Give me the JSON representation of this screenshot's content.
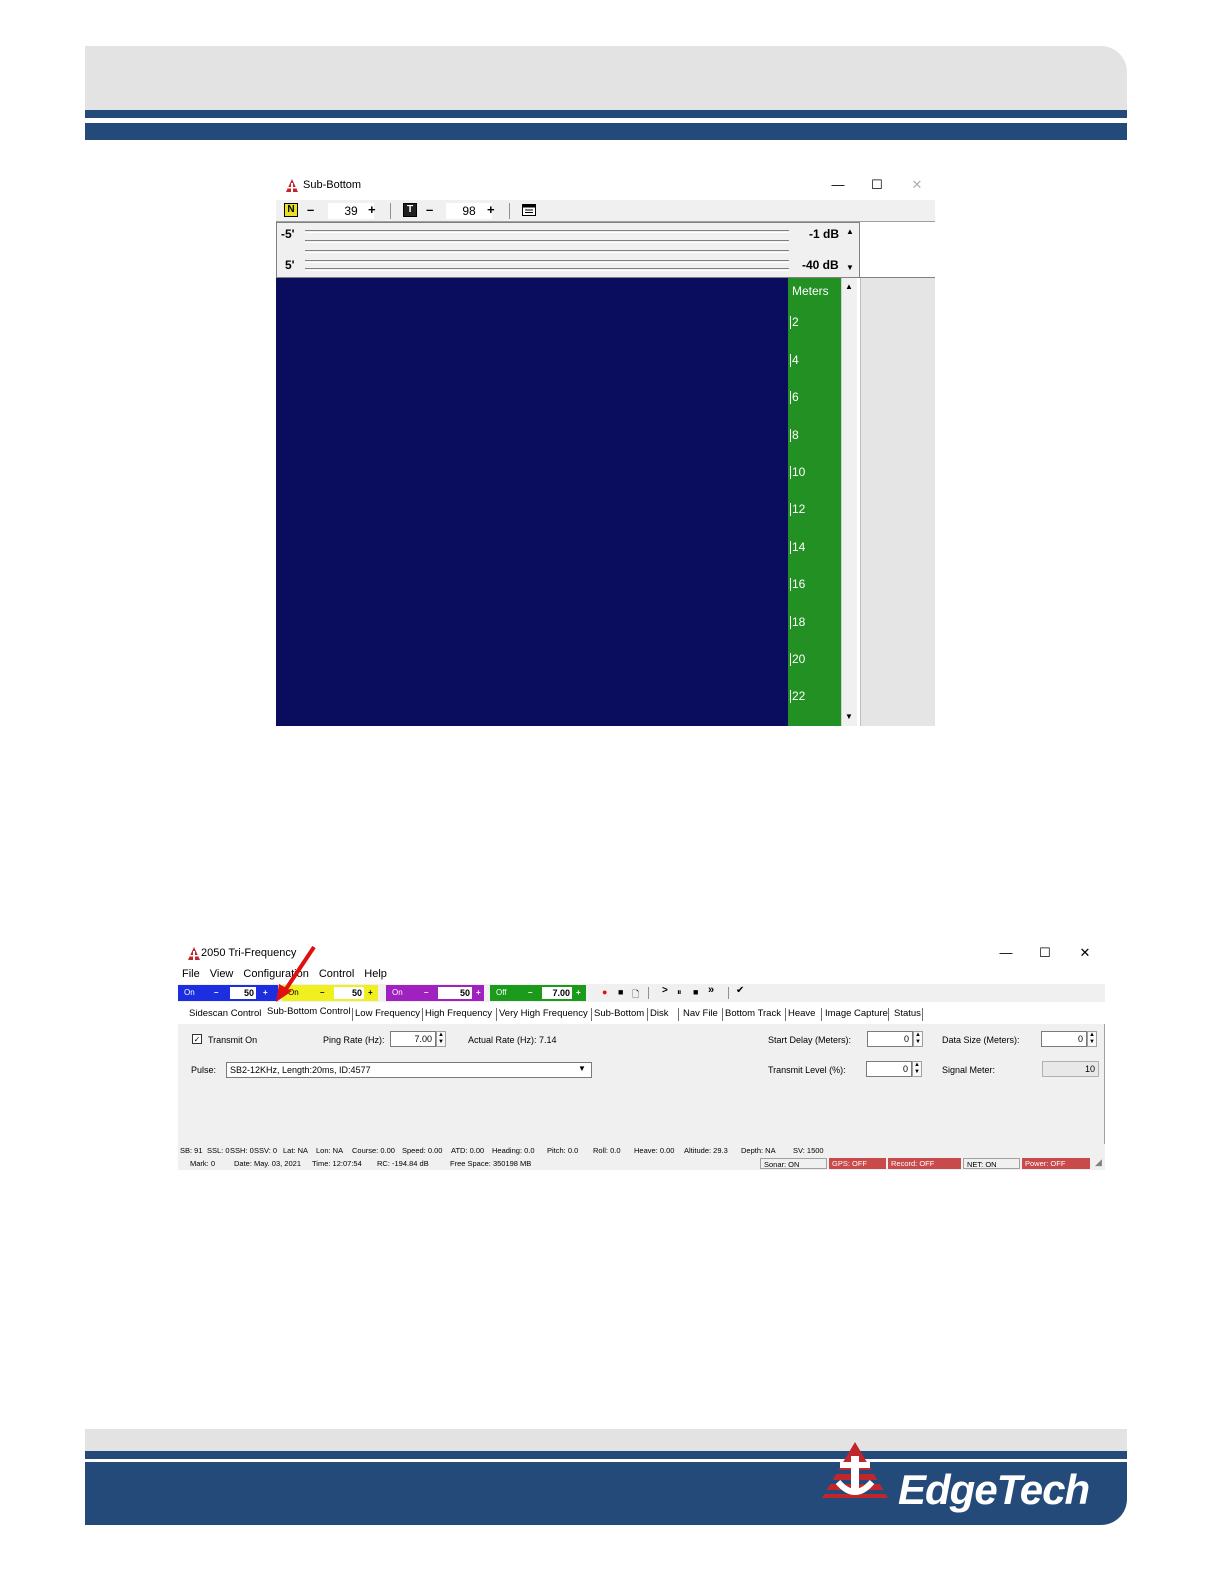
{
  "page": {
    "logo_text": "EdgeTech"
  },
  "sub_bottom_window": {
    "title": "Sub-Bottom",
    "controls": {
      "minimize": "—",
      "maximize": "☐",
      "close": "✕"
    },
    "toolbar": {
      "n_label": "N",
      "n_minus": "–",
      "n_value": "39",
      "n_plus": "+",
      "t_label": "T",
      "t_minus": "–",
      "t_value": "98",
      "t_plus": "+"
    },
    "meter": {
      "top_left": "-5'",
      "bottom_left": "5'",
      "top_right": "-1 dB",
      "bottom_right": "-40 dB"
    },
    "scale": {
      "header": "Meters",
      "ticks": [
        "2",
        "4",
        "6",
        "8",
        "10",
        "12",
        "14",
        "16",
        "18",
        "20",
        "22"
      ]
    },
    "colors": {
      "image_bg": "#0a0c5e",
      "scale_bg": "#239023"
    }
  },
  "tri_freq_window": {
    "title": "2050 Tri-Frequency",
    "controls": {
      "minimize": "—",
      "maximize": "☐",
      "close": "✕"
    },
    "menu": [
      "File",
      "View",
      "Configuration",
      "Control",
      "Help"
    ],
    "toolbar": {
      "blue": {
        "state": "On",
        "minus": "–",
        "value": "50",
        "plus": "+"
      },
      "yellow": {
        "state": "On",
        "minus": "–",
        "value": "50",
        "plus": "+"
      },
      "purple": {
        "state": "On",
        "minus": "–",
        "value": "50",
        "plus": "+"
      },
      "green": {
        "state": "Off",
        "minus": "–",
        "value": "7.00",
        "plus": "+"
      },
      "record_icons": [
        "●",
        "■",
        "🗋",
        ">",
        "⏸",
        "■",
        "»",
        "✔"
      ]
    },
    "tabs": [
      "Sidescan Control",
      "Sub-Bottom Control",
      "Low Frequency",
      "High Frequency",
      "Very High Frequency",
      "Sub-Bottom",
      "Disk",
      "Nav File",
      "Bottom Track",
      "Heave",
      "Image Capture",
      "Status"
    ],
    "panel": {
      "transmit_on_label": "Transmit On",
      "transmit_on_checked": true,
      "ping_rate_label": "Ping Rate (Hz):",
      "ping_rate_value": "7.00",
      "actual_rate_label": "Actual Rate (Hz): 7.14",
      "start_delay_label": "Start Delay (Meters):",
      "start_delay_value": "0",
      "data_size_label": "Data Size (Meters):",
      "data_size_value": "0",
      "pulse_label": "Pulse:",
      "pulse_value": "SB2-12KHz, Length:20ms, ID:4577",
      "transmit_level_label": "Transmit Level (%):",
      "transmit_level_value": "0",
      "signal_meter_label": "Signal Meter:",
      "signal_meter_value": "10"
    },
    "status_line1": [
      "SB: 91",
      "SSL: 0",
      "SSH: 0",
      "SSV: 0",
      "Lat: NA",
      "Lon: NA",
      "Course: 0.00",
      "Speed: 0.00",
      "ATD: 0.00",
      "Heading: 0.0",
      "Pitch: 0.0",
      "Roll: 0.0",
      "Heave: 0.00",
      "Altitude: 29.3",
      "Depth: NA",
      "SV: 1500"
    ],
    "status_line2": [
      "Mark: 0",
      "Date: May. 03, 2021",
      "Time: 12:07:54",
      "RC: -194.84 dB",
      "Free Space: 350198 MB"
    ],
    "status_boxes": [
      {
        "label": "Sonar: ON",
        "color": "#f0f0f0"
      },
      {
        "label": "GPS: OFF",
        "color": "#c84a4a"
      },
      {
        "label": "Record: OFF",
        "color": "#c84a4a"
      },
      {
        "label": "NET: ON",
        "color": "#f0f0f0"
      },
      {
        "label": "Power: OFF",
        "color": "#c84a4a"
      }
    ]
  }
}
